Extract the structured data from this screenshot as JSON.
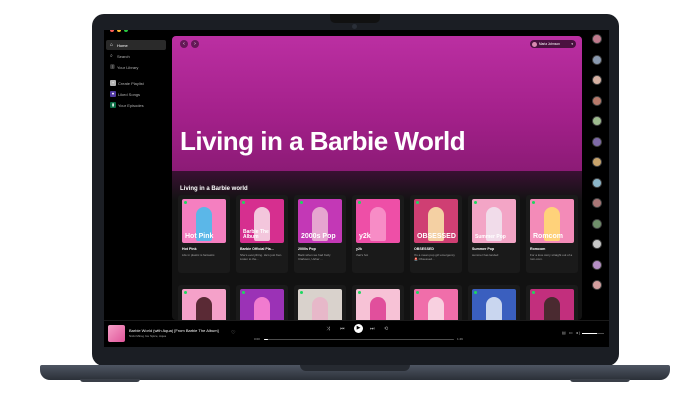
{
  "window": {
    "traffic_lights": [
      "#ff5f57",
      "#febc2e",
      "#28c840"
    ]
  },
  "sidebar": {
    "nav": [
      {
        "label": "Home",
        "icon": "home-icon",
        "glyph": "⌂",
        "active": true
      },
      {
        "label": "Search",
        "icon": "search-icon",
        "glyph": "⌕",
        "active": false
      },
      {
        "label": "Your Library",
        "icon": "library-icon",
        "glyph": "▥",
        "active": false
      }
    ],
    "actions": [
      {
        "label": "Create Playlist",
        "icon": "plus-icon",
        "glyph": "+",
        "color": "#b3b3b3"
      },
      {
        "label": "Liked Songs",
        "icon": "heart-icon",
        "glyph": "♥",
        "color": "#5038a0"
      },
      {
        "label": "Your Episodes",
        "icon": "bookmark-icon",
        "glyph": "▮",
        "color": "#0a6b43"
      }
    ]
  },
  "header": {
    "back": "‹",
    "forward": "›",
    "user_name": "Maria Johnson",
    "user_caret": "▾"
  },
  "hero": {
    "title": "Living in a Barbie World"
  },
  "section": {
    "title": "Living in a Barbie world"
  },
  "cards_row1": [
    {
      "title": "Hot Pink",
      "desc": "Life in plastic is fantastic.",
      "tag": "Hot Pink",
      "bg": "#f57fc0",
      "fig": "#5bb7e8"
    },
    {
      "title": "Barbie Official Pla...",
      "desc": "She's everything. He's just Ken. Listen to the...",
      "tag": "Barbie The Album",
      "bg": "#d62f8f",
      "fig": "#f3c6dc"
    },
    {
      "title": "2000s Pop",
      "desc": "Back when we had Kelly Clarkson, Usher ...",
      "tag": "2000s Pop",
      "bg": "#c338b6",
      "fig": "#e6a5d0"
    },
    {
      "title": "y2k",
      "desc": "that's hot",
      "tag": "y2k",
      "bg": "#ee4fa7",
      "fig": "#f78cc6"
    },
    {
      "title": "OBSESSED",
      "desc": "It's a mean pop girl emergency 🚨 Obsessed...",
      "tag": "OBSESSED",
      "bg": "#cf3f73",
      "fig": "#f4d0a3"
    },
    {
      "title": "Summer Pop",
      "desc": "summer has landed",
      "tag": "Summer Pop",
      "bg": "#f3a5c6",
      "fig": "#f1dcea"
    },
    {
      "title": "Romcom",
      "desc": "For a love story straight out of a rom-com.",
      "tag": "Romcom",
      "bg": "#f38bb8",
      "fig": "#ffd27a"
    }
  ],
  "cards_row2": [
    {
      "bg": "#f5a1c9",
      "fig": "#5a2a35",
      "tag": ""
    },
    {
      "bg": "#9b32b6",
      "fig": "#f17bcf",
      "tag": ""
    },
    {
      "bg": "#d9d2cc",
      "fig": "#e7b8c9",
      "tag": ""
    },
    {
      "bg": "#f7c2d6",
      "fig": "#e14f9c",
      "tag": ""
    },
    {
      "bg": "#f06eaa",
      "fig": "#f8d0e0",
      "tag": ""
    },
    {
      "bg": "#3a5fbf",
      "fig": "#c9d6ef",
      "tag": ""
    },
    {
      "bg": "#c22f7d",
      "fig": "#4a2a30",
      "tag": ""
    }
  ],
  "friends": [
    "#c07a8d",
    "#8a9ab0",
    "#d7b1a2",
    "#b87a6b",
    "#9dbb8e",
    "#7e6aa8",
    "#c9a46b",
    "#8bb6c9",
    "#a97676",
    "#6f8f6a",
    "#c8c8c8",
    "#b58fc4",
    "#d4a0a0"
  ],
  "player": {
    "title": "Barbie World (with Aqua) [From Barbie The Album]",
    "artist": "Nicki Minaj, Ice Spice, Aqua",
    "heart": "♡",
    "shuffle": "⤨",
    "prev": "⏮",
    "play": "▶",
    "next": "⏭",
    "repeat": "⟲",
    "elapsed": "0:00",
    "duration": "1:49",
    "progress": 0.02,
    "volume": 0.7,
    "vol_icons": "▤ ▭ ◂)"
  }
}
